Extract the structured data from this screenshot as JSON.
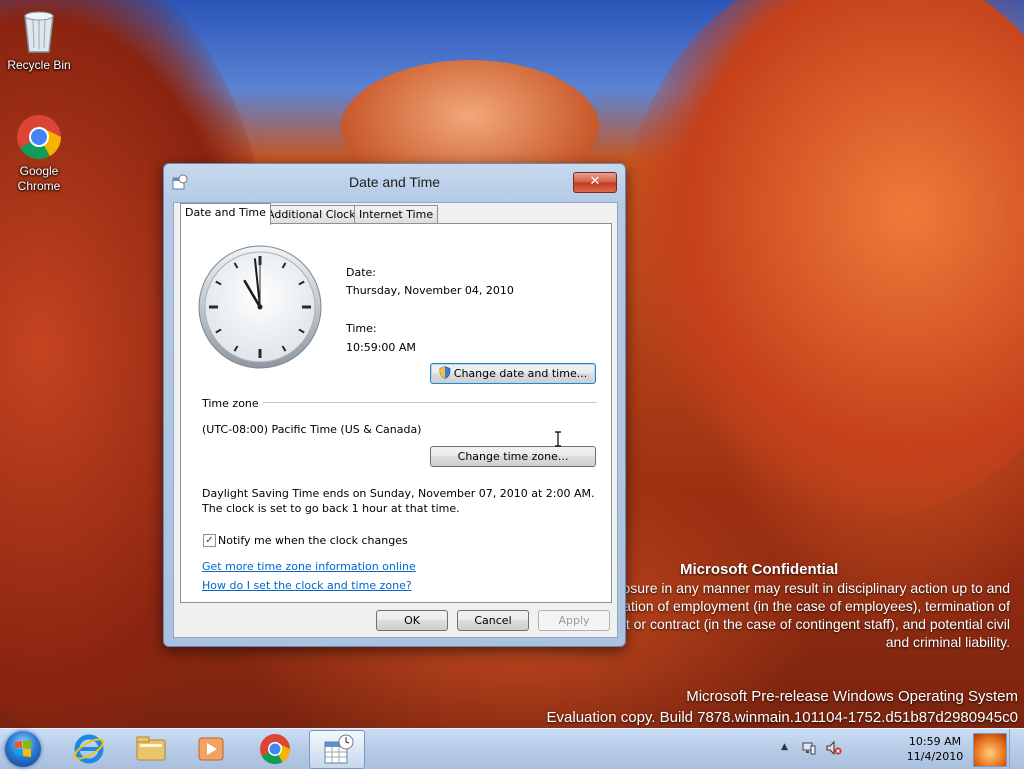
{
  "desktop": {
    "icons": [
      {
        "label": "Recycle Bin",
        "icon": "recycle-bin-icon"
      },
      {
        "label": "Google\nChrome",
        "icon": "chrome-icon"
      }
    ],
    "watermark": {
      "title": "Microsoft Confidential",
      "body": "...use or disclosure in any manner may result in disciplinary action up to and including termination of employment (in the case of employees), termination of an assignment or contract (in the case of contingent staff), and potential civil and criminal liability.",
      "build_line1": "Microsoft Pre-release Windows Operating System",
      "build_line2": "Evaluation copy. Build 7878.winmain.101104-1752.d51b87d2980945c0"
    }
  },
  "dialog": {
    "title": "Date and Time",
    "close_label": "✕",
    "tabs": [
      {
        "label": "Date and Time",
        "active": true
      },
      {
        "label": "Additional Clocks",
        "active": false
      },
      {
        "label": "Internet Time",
        "active": false
      }
    ],
    "clock": {
      "hour": 10,
      "minute": 59,
      "second": 0
    },
    "date_label": "Date:",
    "date_value": "Thursday, November 04, 2010",
    "time_label": "Time:",
    "time_value": "10:59:00 AM",
    "change_datetime_button": "Change date and time...",
    "timezone_heading": "Time zone",
    "timezone_value": "(UTC-08:00) Pacific Time (US & Canada)",
    "change_timezone_button": "Change time zone...",
    "dst_text": "Daylight Saving Time ends on Sunday, November 07, 2010 at 2:00 AM. The clock is set to go back 1 hour at that time.",
    "notify_checkbox": {
      "label": "Notify me when the clock changes",
      "checked": true
    },
    "links": {
      "more_info": "Get more time zone information online",
      "how_to": "How do I set the clock and time zone?"
    },
    "buttons": {
      "ok": "OK",
      "cancel": "Cancel",
      "apply": "Apply"
    }
  },
  "taskbar": {
    "pinned": [
      {
        "icon": "internet-explorer-icon"
      },
      {
        "icon": "file-explorer-icon"
      },
      {
        "icon": "media-player-icon"
      },
      {
        "icon": "chrome-icon"
      },
      {
        "icon": "date-time-control-panel-icon",
        "active": true
      }
    ],
    "tray_icons": [
      "show-hidden-icons-icon",
      "network-icon",
      "volume-muted-icon"
    ],
    "clock_time": "10:59 AM",
    "clock_date": "11/4/2010"
  }
}
